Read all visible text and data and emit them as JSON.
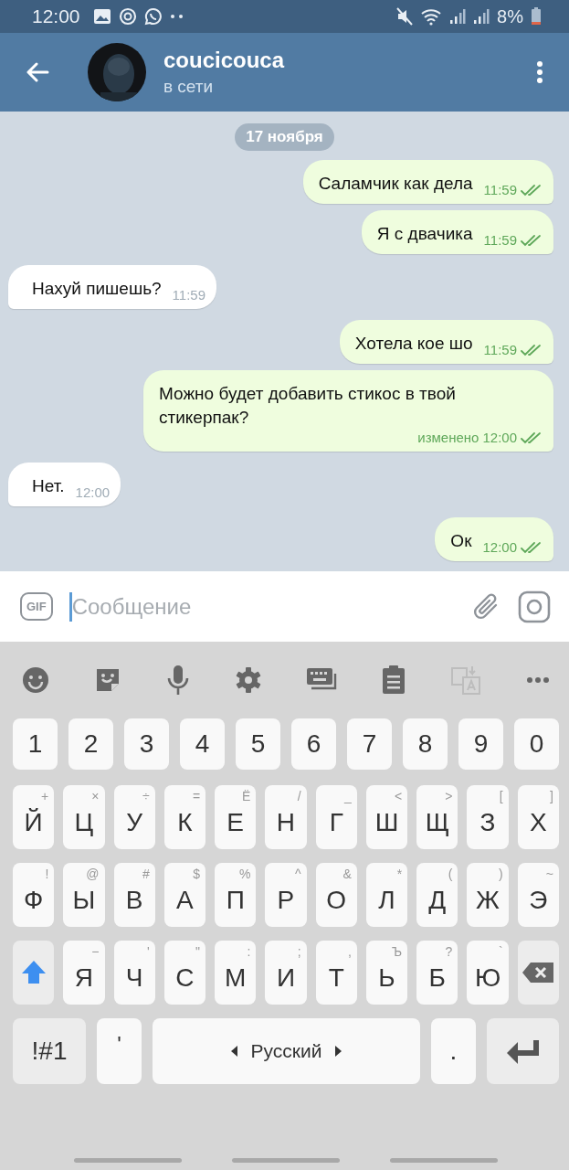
{
  "status_bar": {
    "time": "12:00",
    "battery": "8%"
  },
  "header": {
    "name": "coucicouca",
    "status": "в сети"
  },
  "date_badge": "17 ноября",
  "messages": [
    {
      "kind": "outgoing",
      "text": "Саламчик как дела",
      "time": "11:59"
    },
    {
      "kind": "outgoing",
      "text": "Я с двачика",
      "time": "11:59"
    },
    {
      "kind": "incoming",
      "text": "Нахуй пишешь?",
      "time": "11:59"
    },
    {
      "kind": "outgoing",
      "text": "Хотела кое шо",
      "time": "11:59"
    },
    {
      "kind": "outgoing",
      "text": "Можно будет добавить стикос в твой стикерпак?",
      "time": "12:00",
      "edited": "изменено"
    },
    {
      "kind": "incoming",
      "text": "Нет.",
      "time": "12:00"
    },
    {
      "kind": "outgoing",
      "text": "Ок",
      "time": "12:00"
    }
  ],
  "composer": {
    "gif_label": "GIF",
    "placeholder": "Сообщение"
  },
  "keyboard": {
    "shift_on": true,
    "number_row": [
      "1",
      "2",
      "3",
      "4",
      "5",
      "6",
      "7",
      "8",
      "9",
      "0"
    ],
    "letter_rows": [
      [
        {
          "label": "Й",
          "hint": "+"
        },
        {
          "label": "Ц",
          "hint": "×"
        },
        {
          "label": "У",
          "hint": "÷"
        },
        {
          "label": "К",
          "hint": "="
        },
        {
          "label": "Е",
          "hint": "Ё"
        },
        {
          "label": "Н",
          "hint": "/"
        },
        {
          "label": "Г",
          "hint": "_"
        },
        {
          "label": "Ш",
          "hint": "<"
        },
        {
          "label": "Щ",
          "hint": ">"
        },
        {
          "label": "З",
          "hint": "["
        },
        {
          "label": "Х",
          "hint": "]"
        }
      ],
      [
        {
          "label": "Ф",
          "hint": "!"
        },
        {
          "label": "Ы",
          "hint": "@"
        },
        {
          "label": "В",
          "hint": "#"
        },
        {
          "label": "А",
          "hint": "$"
        },
        {
          "label": "П",
          "hint": "%"
        },
        {
          "label": "Р",
          "hint": "^"
        },
        {
          "label": "О",
          "hint": "&"
        },
        {
          "label": "Л",
          "hint": "*"
        },
        {
          "label": "Д",
          "hint": "("
        },
        {
          "label": "Ж",
          "hint": ")"
        },
        {
          "label": "Э",
          "hint": "~"
        }
      ],
      [
        {
          "label": "Я",
          "hint": "−"
        },
        {
          "label": "Ч",
          "hint": "'"
        },
        {
          "label": "С",
          "hint": "\""
        },
        {
          "label": "М",
          "hint": ":"
        },
        {
          "label": "И",
          "hint": ";"
        },
        {
          "label": "Т",
          "hint": ","
        },
        {
          "label": "Ь",
          "hint": "Ъ"
        },
        {
          "label": "Б",
          "hint": "?"
        },
        {
          "label": "Ю",
          "hint": "`"
        }
      ]
    ],
    "symbols_key": "!#1",
    "apostrophe_key": "'",
    "space_label": "Русский",
    "period_key": "."
  }
}
